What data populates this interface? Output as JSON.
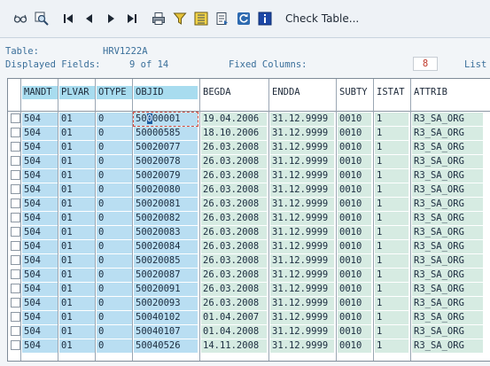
{
  "toolbar": {
    "buttons": [
      "glasses-icon",
      "magnify-icon",
      "first-page-icon",
      "prev-page-icon",
      "next-page-icon",
      "last-page-icon",
      "print-icon",
      "filter-icon",
      "sum-icon",
      "export-icon",
      "refresh-icon",
      "info-icon"
    ],
    "check_table_label": "Check Table..."
  },
  "info": {
    "table_label": "Table:",
    "table_value": "HRV1222A",
    "displayed_label": "Displayed Fields:",
    "displayed_value": "9 of  14",
    "fixed_label": "Fixed Columns:",
    "fixed_value": "8",
    "list_label": "List"
  },
  "columns": [
    "MANDT",
    "PLVAR",
    "OTYPE",
    "OBJID",
    "BEGDA",
    "ENDDA",
    "SUBTY",
    "ISTAT",
    "ATTRIB"
  ],
  "rows": [
    [
      "504",
      "01",
      "0",
      "50000001",
      "19.04.2006",
      "31.12.9999",
      "0010",
      "1",
      "R3_SA_ORG"
    ],
    [
      "504",
      "01",
      "0",
      "50000585",
      "18.10.2006",
      "31.12.9999",
      "0010",
      "1",
      "R3_SA_ORG"
    ],
    [
      "504",
      "01",
      "0",
      "50020077",
      "26.03.2008",
      "31.12.9999",
      "0010",
      "1",
      "R3_SA_ORG"
    ],
    [
      "504",
      "01",
      "0",
      "50020078",
      "26.03.2008",
      "31.12.9999",
      "0010",
      "1",
      "R3_SA_ORG"
    ],
    [
      "504",
      "01",
      "0",
      "50020079",
      "26.03.2008",
      "31.12.9999",
      "0010",
      "1",
      "R3_SA_ORG"
    ],
    [
      "504",
      "01",
      "0",
      "50020080",
      "26.03.2008",
      "31.12.9999",
      "0010",
      "1",
      "R3_SA_ORG"
    ],
    [
      "504",
      "01",
      "0",
      "50020081",
      "26.03.2008",
      "31.12.9999",
      "0010",
      "1",
      "R3_SA_ORG"
    ],
    [
      "504",
      "01",
      "0",
      "50020082",
      "26.03.2008",
      "31.12.9999",
      "0010",
      "1",
      "R3_SA_ORG"
    ],
    [
      "504",
      "01",
      "0",
      "50020083",
      "26.03.2008",
      "31.12.9999",
      "0010",
      "1",
      "R3_SA_ORG"
    ],
    [
      "504",
      "01",
      "0",
      "50020084",
      "26.03.2008",
      "31.12.9999",
      "0010",
      "1",
      "R3_SA_ORG"
    ],
    [
      "504",
      "01",
      "0",
      "50020085",
      "26.03.2008",
      "31.12.9999",
      "0010",
      "1",
      "R3_SA_ORG"
    ],
    [
      "504",
      "01",
      "0",
      "50020087",
      "26.03.2008",
      "31.12.9999",
      "0010",
      "1",
      "R3_SA_ORG"
    ],
    [
      "504",
      "01",
      "0",
      "50020091",
      "26.03.2008",
      "31.12.9999",
      "0010",
      "1",
      "R3_SA_ORG"
    ],
    [
      "504",
      "01",
      "0",
      "50020093",
      "26.03.2008",
      "31.12.9999",
      "0010",
      "1",
      "R3_SA_ORG"
    ],
    [
      "504",
      "01",
      "0",
      "50040102",
      "01.04.2007",
      "31.12.9999",
      "0010",
      "1",
      "R3_SA_ORG"
    ],
    [
      "504",
      "01",
      "0",
      "50040107",
      "01.04.2008",
      "31.12.9999",
      "0010",
      "1",
      "R3_SA_ORG"
    ],
    [
      "504",
      "01",
      "0",
      "50040526",
      "14.11.2008",
      "31.12.9999",
      "0010",
      "1",
      "R3_SA_ORG"
    ]
  ],
  "colors": {
    "key_col": "#b9def2",
    "val_col": "#d6ebe2",
    "label": "#3a6f9a"
  }
}
